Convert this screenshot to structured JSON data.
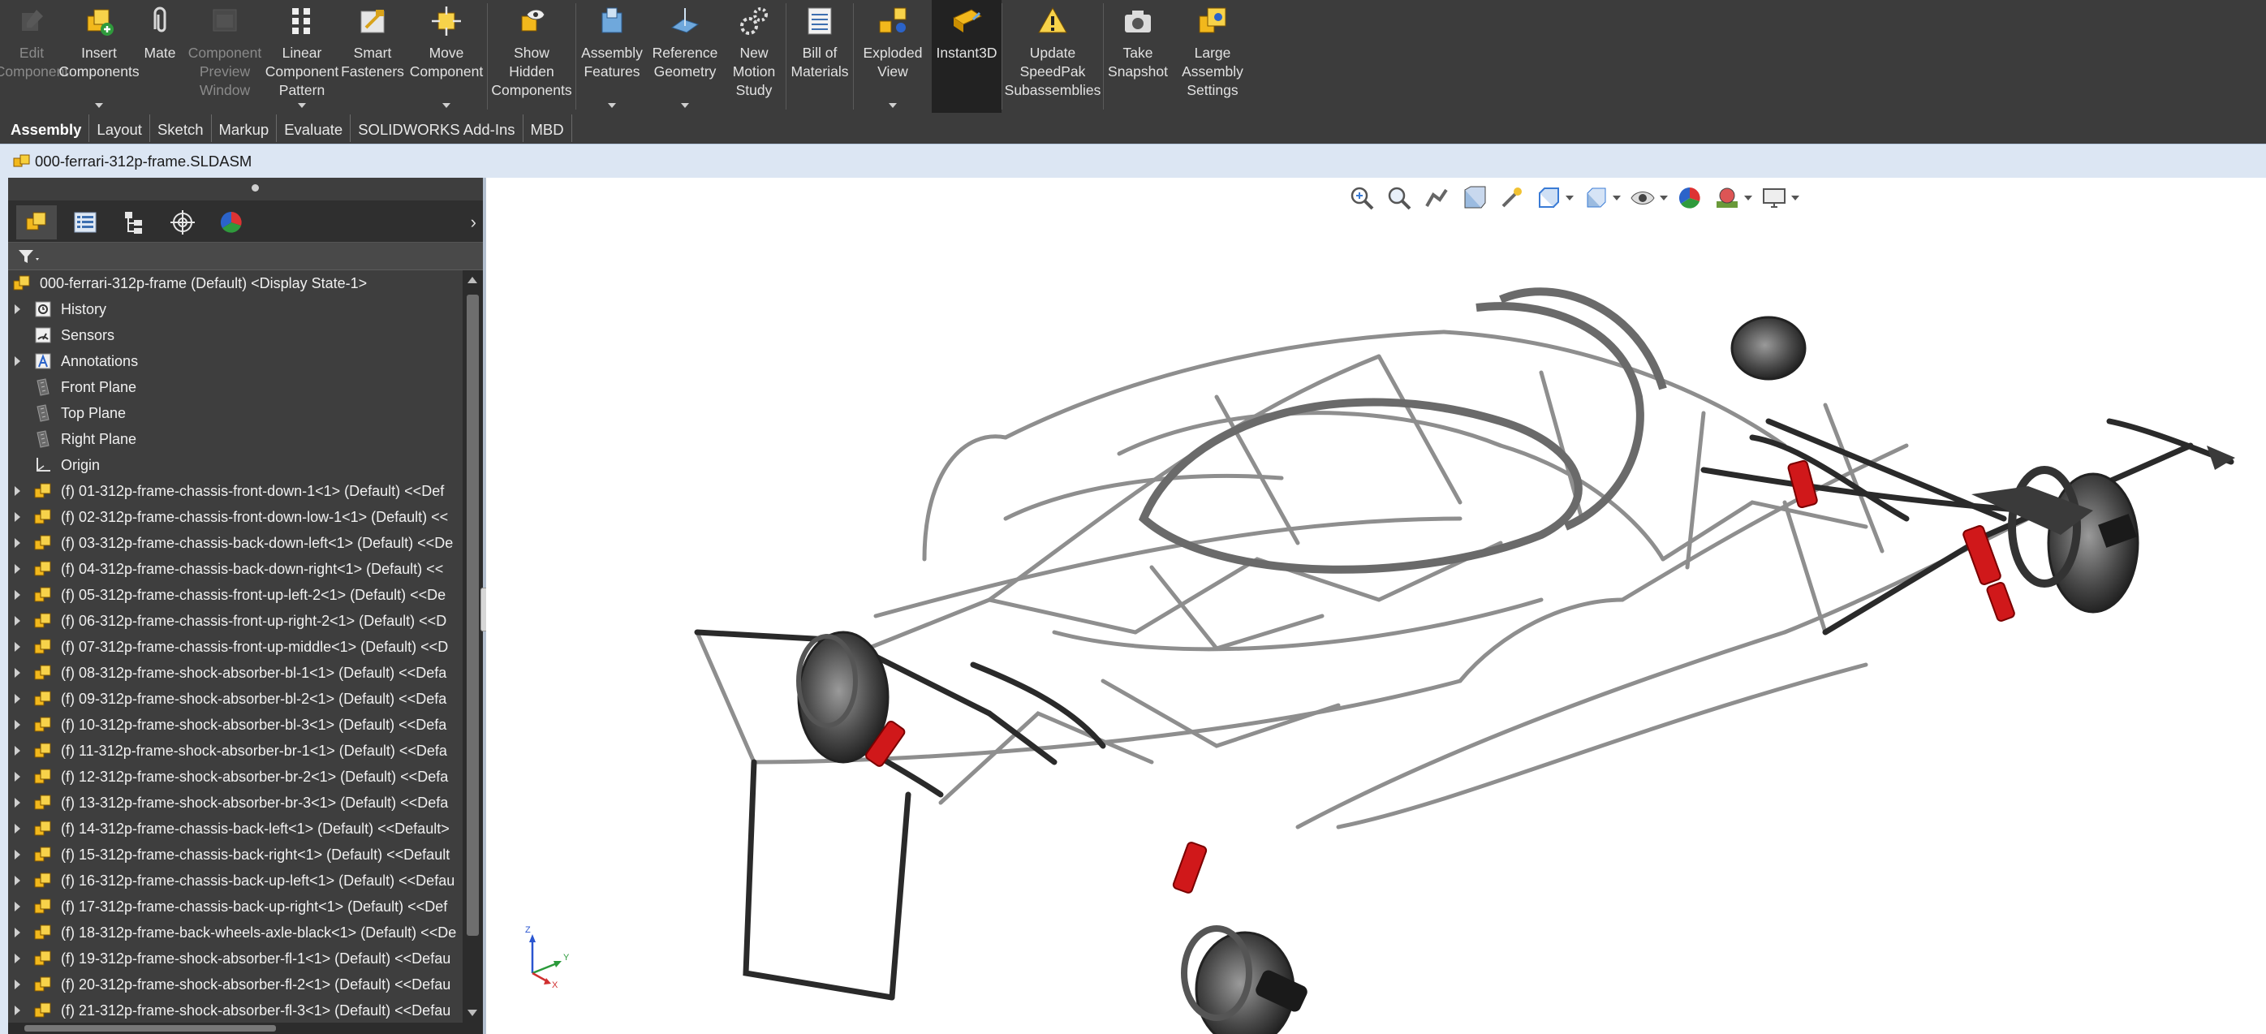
{
  "ribbon": {
    "buttons": [
      {
        "label": "Edit\nComponent",
        "icon": "edit-component-icon",
        "disabled": true
      },
      {
        "label": "Insert\nComponents",
        "icon": "insert-components-icon",
        "dropdown": true
      },
      {
        "label": "Mate",
        "icon": "mate-paperclip-icon"
      },
      {
        "label": "Component\nPreview\nWindow",
        "icon": "component-preview-icon",
        "disabled": true
      },
      {
        "label": "Linear\nComponent\nPattern",
        "icon": "linear-pattern-icon",
        "dropdown": true
      },
      {
        "label": "Smart\nFasteners",
        "icon": "smart-fasteners-icon"
      },
      {
        "label": "Move\nComponent",
        "icon": "move-component-icon",
        "dropdown": true
      },
      {
        "label": "Show\nHidden\nComponents",
        "icon": "show-hidden-icon"
      },
      {
        "label": "Assembly\nFeatures",
        "icon": "assembly-features-icon",
        "dropdown": true
      },
      {
        "label": "Reference\nGeometry",
        "icon": "reference-geometry-icon",
        "dropdown": true
      },
      {
        "label": "New\nMotion\nStudy",
        "icon": "motion-study-icon"
      },
      {
        "label": "Bill of\nMaterials",
        "icon": "bill-of-materials-icon"
      },
      {
        "label": "Exploded\nView",
        "icon": "exploded-view-icon",
        "dropdown": true
      },
      {
        "label": "Instant3D",
        "icon": "instant3d-icon",
        "active": true
      },
      {
        "label": "Update\nSpeedPak\nSubassemblies",
        "icon": "speedpak-warning-icon"
      },
      {
        "label": "Take\nSnapshot",
        "icon": "camera-icon"
      },
      {
        "label": "Large\nAssembly\nSettings",
        "icon": "large-assembly-icon"
      }
    ]
  },
  "tabs": [
    {
      "label": "Assembly",
      "active": true
    },
    {
      "label": "Layout"
    },
    {
      "label": "Sketch"
    },
    {
      "label": "Markup"
    },
    {
      "label": "Evaluate"
    },
    {
      "label": "SOLIDWORKS Add-Ins"
    },
    {
      "label": "MBD"
    }
  ],
  "document": {
    "title": "000-ferrari-312p-frame.SLDASM"
  },
  "feature_tree": {
    "root": "000-ferrari-312p-frame (Default) <Display State-1>",
    "items": [
      {
        "label": "History",
        "icon": "history-icon",
        "expandable": true
      },
      {
        "label": "Sensors",
        "icon": "sensors-icon",
        "expandable": false
      },
      {
        "label": "Annotations",
        "icon": "annotations-icon",
        "expandable": true
      },
      {
        "label": "Front Plane",
        "icon": "plane-icon",
        "expandable": false
      },
      {
        "label": "Top Plane",
        "icon": "plane-icon",
        "expandable": false
      },
      {
        "label": "Right Plane",
        "icon": "plane-icon",
        "expandable": false
      },
      {
        "label": "Origin",
        "icon": "origin-icon",
        "expandable": false
      },
      {
        "label": "(f) 01-312p-frame-chassis-front-down-1<1> (Default) <<Def",
        "icon": "part-icon",
        "expandable": true
      },
      {
        "label": "(f) 02-312p-frame-chassis-front-down-low-1<1> (Default) <<",
        "icon": "part-icon",
        "expandable": true
      },
      {
        "label": "(f) 03-312p-frame-chassis-back-down-left<1> (Default) <<De",
        "icon": "part-icon",
        "expandable": true
      },
      {
        "label": "(f) 04-312p-frame-chassis-back-down-right<1> (Default) <<",
        "icon": "part-icon",
        "expandable": true
      },
      {
        "label": "(f) 05-312p-frame-chassis-front-up-left-2<1> (Default) <<De",
        "icon": "part-icon",
        "expandable": true
      },
      {
        "label": "(f) 06-312p-frame-chassis-front-up-right-2<1> (Default) <<D",
        "icon": "part-icon",
        "expandable": true
      },
      {
        "label": "(f) 07-312p-frame-chassis-front-up-middle<1> (Default) <<D",
        "icon": "part-icon",
        "expandable": true
      },
      {
        "label": "(f) 08-312p-frame-shock-absorber-bl-1<1> (Default) <<Defa",
        "icon": "part-icon",
        "expandable": true
      },
      {
        "label": "(f) 09-312p-frame-shock-absorber-bl-2<1> (Default) <<Defa",
        "icon": "part-icon",
        "expandable": true
      },
      {
        "label": "(f) 10-312p-frame-shock-absorber-bl-3<1> (Default) <<Defa",
        "icon": "part-icon",
        "expandable": true
      },
      {
        "label": "(f) 11-312p-frame-shock-absorber-br-1<1> (Default) <<Defa",
        "icon": "part-icon",
        "expandable": true
      },
      {
        "label": "(f) 12-312p-frame-shock-absorber-br-2<1> (Default) <<Defa",
        "icon": "part-icon",
        "expandable": true
      },
      {
        "label": "(f) 13-312p-frame-shock-absorber-br-3<1> (Default) <<Defa",
        "icon": "part-icon",
        "expandable": true
      },
      {
        "label": "(f) 14-312p-frame-chassis-back-left<1> (Default) <<Default>",
        "icon": "part-icon",
        "expandable": true
      },
      {
        "label": "(f) 15-312p-frame-chassis-back-right<1> (Default) <<Default",
        "icon": "part-icon",
        "expandable": true
      },
      {
        "label": "(f) 16-312p-frame-chassis-back-up-left<1> (Default) <<Defau",
        "icon": "part-icon",
        "expandable": true
      },
      {
        "label": "(f) 17-312p-frame-chassis-back-up-right<1> (Default) <<Def",
        "icon": "part-icon",
        "expandable": true
      },
      {
        "label": "(f) 18-312p-frame-back-wheels-axle-black<1> (Default) <<De",
        "icon": "part-icon",
        "expandable": true
      },
      {
        "label": "(f) 19-312p-frame-shock-absorber-fl-1<1> (Default) <<Defau",
        "icon": "part-icon",
        "expandable": true
      },
      {
        "label": "(f) 20-312p-frame-shock-absorber-fl-2<1> (Default) <<Defau",
        "icon": "part-icon",
        "expandable": true
      },
      {
        "label": "(f) 21-312p-frame-shock-absorber-fl-3<1> (Default) <<Defau",
        "icon": "part-icon",
        "expandable": true
      }
    ]
  },
  "triad": {
    "z": "Z",
    "y": "Y",
    "x": "X"
  },
  "colors": {
    "ribbon_bg": "#3c3c3c",
    "panel_bg": "#3e3e3e",
    "doc_bar": "#dce6f3",
    "shock_red": "#d0181a"
  }
}
